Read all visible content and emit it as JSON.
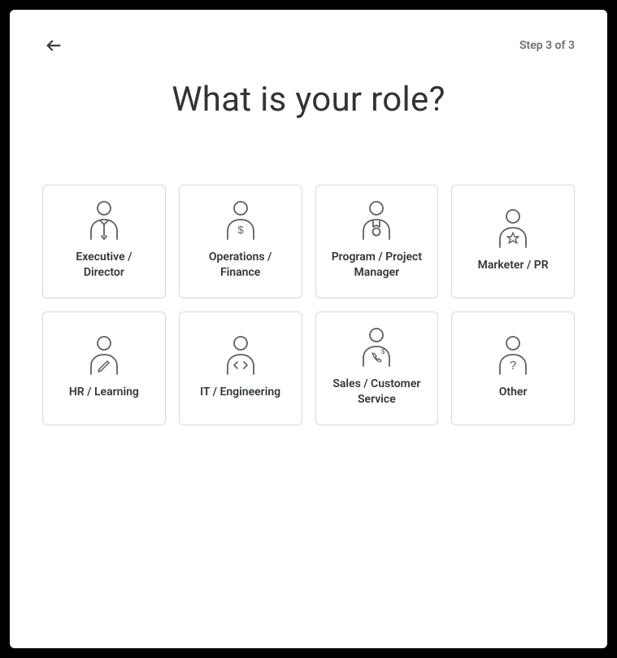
{
  "header": {
    "step_text": "Step 3 of 3"
  },
  "title": "What is your role?",
  "roles": [
    {
      "id": "executive",
      "label": "Executive /\nDirector",
      "icon": "person-tie-icon"
    },
    {
      "id": "operations",
      "label": "Operations /\nFinance",
      "icon": "person-dollar-icon"
    },
    {
      "id": "pmpm",
      "label": "Program / Project\nManager",
      "icon": "person-medal-icon"
    },
    {
      "id": "marketing",
      "label": "Marketer / PR",
      "icon": "person-star-icon"
    },
    {
      "id": "hr",
      "label": "HR / Learning",
      "icon": "person-pencil-icon"
    },
    {
      "id": "it",
      "label": "IT / Engineering",
      "icon": "person-code-icon"
    },
    {
      "id": "sales",
      "label": "Sales / Customer\nService",
      "icon": "person-phone-icon"
    },
    {
      "id": "other",
      "label": "Other",
      "icon": "person-question-icon"
    }
  ]
}
